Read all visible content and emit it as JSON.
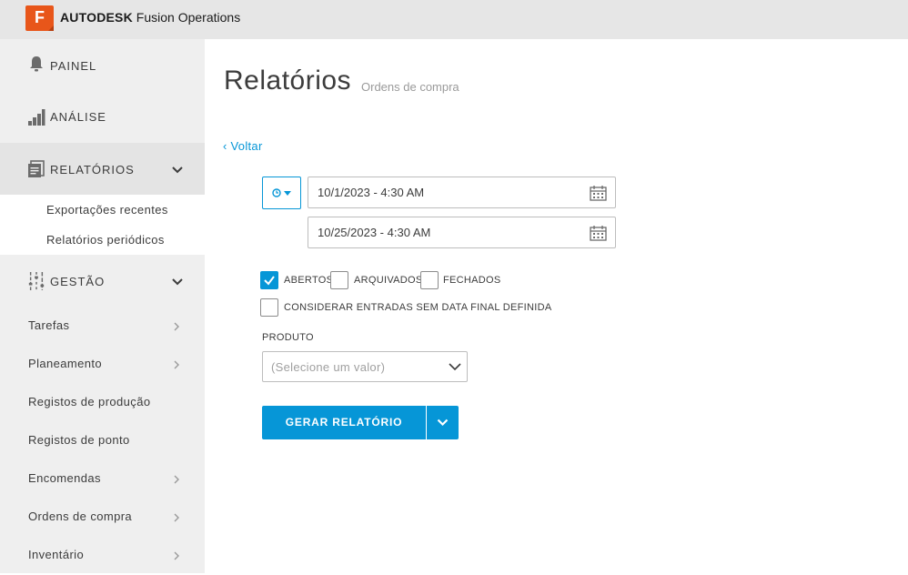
{
  "header": {
    "logo_letter": "F",
    "brand_bold": "AUTODESK",
    "brand_rest": "Fusion Operations"
  },
  "sidebar": {
    "top_items": [
      {
        "label": "PAINEL",
        "icon": "bell-icon"
      },
      {
        "label": "ANÁLISE",
        "icon": "bar-chart-icon"
      },
      {
        "label": "RELATÓRIOS",
        "icon": "reports-icon",
        "expanded": true
      }
    ],
    "report_subitems": [
      "Exportações recentes",
      "Relatórios periódicos"
    ],
    "management": {
      "label": "GESTÃO",
      "icon": "sliders-icon"
    },
    "management_items": [
      {
        "label": "Tarefas",
        "has_arrow": true
      },
      {
        "label": "Planeamento",
        "has_arrow": true
      },
      {
        "label": "Registos de produção",
        "has_arrow": false
      },
      {
        "label": "Registos de ponto",
        "has_arrow": false
      },
      {
        "label": "Encomendas",
        "has_arrow": true
      },
      {
        "label": "Ordens de compra",
        "has_arrow": true
      },
      {
        "label": "Inventário",
        "has_arrow": true
      }
    ]
  },
  "main": {
    "title": "Relatórios",
    "subtitle": "Ordens de compra",
    "back_label": "‹ Voltar",
    "date_from": "10/1/2023 - 4:30 AM",
    "date_to": "10/25/2023 - 4:30 AM",
    "filters": [
      {
        "label": "ABERTOS",
        "checked": true
      },
      {
        "label": "ARQUIVADOS",
        "checked": false
      },
      {
        "label": "FECHADOS",
        "checked": false
      }
    ],
    "undated_filter": {
      "label": "CONSIDERAR ENTRADAS SEM DATA FINAL DEFINIDA",
      "checked": false
    },
    "product_label": "PRODUTO",
    "product_placeholder": "(Selecione um valor)",
    "generate_label": "GERAR RELATÓRIO"
  },
  "colors": {
    "accent": "#0696d7",
    "brand": "#e8561a",
    "sidebar_bg": "#efefef",
    "topbar_bg": "#e6e6e6"
  }
}
